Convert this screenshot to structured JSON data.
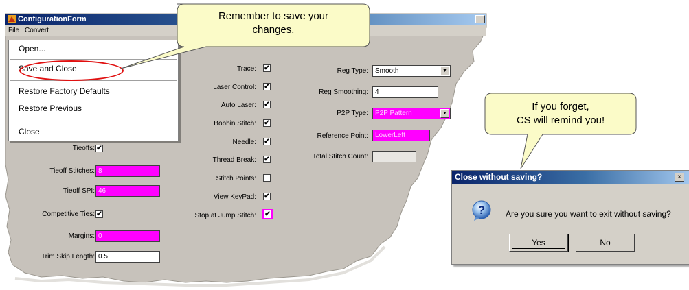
{
  "window": {
    "title": "ConfigurationForm"
  },
  "menubar": {
    "file": "File",
    "convert": "Convert"
  },
  "file_menu": {
    "items": [
      {
        "label": "Open..."
      },
      {
        "label": "Save and Close"
      },
      {
        "label": "Restore Factory Defaults"
      },
      {
        "label": "Restore Previous"
      },
      {
        "label": "Close"
      }
    ]
  },
  "callouts": {
    "save": {
      "line1": "Remember to save your",
      "line2": "changes."
    },
    "remind": {
      "line1": "If you forget,",
      "line2": "CS will remind you!"
    }
  },
  "left_col": {
    "tieoffs": {
      "label": "Tieoffs:",
      "check": "✔"
    },
    "tieoff_stitches": {
      "label": "Tieoff Stitches:",
      "value": "8"
    },
    "tieoff_spi": {
      "label": "Tieoff SPI:",
      "value": "46"
    },
    "competitive_ties": {
      "label": "Competitive Ties:",
      "check": "✔"
    },
    "margins": {
      "label": "Margins:",
      "value": "0"
    },
    "trim_skip_length": {
      "label": "Trim Skip Length:",
      "value": "0.5"
    }
  },
  "mid_col": {
    "trace": {
      "label": "Trace:",
      "check": "✔"
    },
    "laser_control": {
      "label": "Laser Control:",
      "check": "✔"
    },
    "auto_laser": {
      "label": "Auto Laser:",
      "check": "✔"
    },
    "bobbin_stitch": {
      "label": "Bobbin Stitch:",
      "check": "✔"
    },
    "needle": {
      "label": "Needle:",
      "check": "✔"
    },
    "thread_break": {
      "label": "Thread Break:",
      "check": "✔"
    },
    "stitch_points": {
      "label": "Stitch Points:",
      "check": ""
    },
    "view_keypad": {
      "label": "View KeyPad:",
      "check": "✔"
    },
    "stop_at_jump_stitch": {
      "label": "Stop at Jump Stitch:",
      "check": "✔"
    }
  },
  "right_col": {
    "reg_type": {
      "label": "Reg Type:",
      "value": "Smooth"
    },
    "reg_smoothing": {
      "label": "Reg Smoothing:",
      "value": "4"
    },
    "p2p_type": {
      "label": "P2P Type:",
      "value": "P2P Pattern"
    },
    "reference_point": {
      "label": "Reference Point:",
      "value": "LowerLeft"
    },
    "total_stitch_count": {
      "label": "Total Stitch Count:",
      "value": ""
    }
  },
  "dialog": {
    "title": "Close without saving?",
    "close_glyph": "×",
    "icon_glyph": "?",
    "message": "Are you sure you want to exit without saving?",
    "yes": "Yes",
    "no": "No"
  },
  "colors": {
    "form_bg": "#c7c2bb",
    "highlight_field": "#ff00ff",
    "callout_fill": "#fbfbc8",
    "oval": "#e01010",
    "title_blue": "#0a246a"
  }
}
